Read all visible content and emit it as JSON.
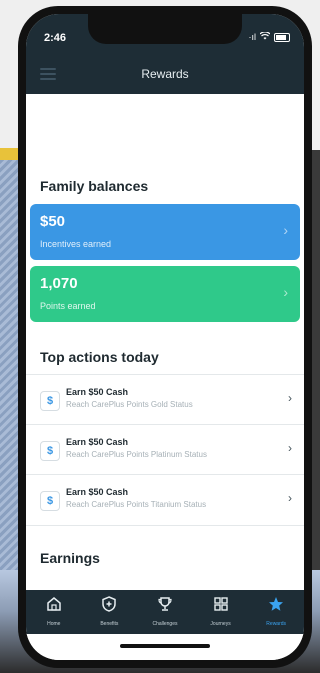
{
  "status": {
    "time": "2:46",
    "signal": "·ıl"
  },
  "header": {
    "title": "Rewards"
  },
  "family_balances": {
    "title": "Family balances",
    "cards": [
      {
        "value": "$50",
        "label": "Incentives earned",
        "color": "#3a97e4"
      },
      {
        "value": "1,070",
        "label": "Points earned",
        "color": "#2fc98a"
      }
    ]
  },
  "top_actions": {
    "title": "Top actions today",
    "items": [
      {
        "icon": "$",
        "title": "Earn $50 Cash",
        "subtitle": "Reach CarePlus Points Gold Status"
      },
      {
        "icon": "$",
        "title": "Earn $50 Cash",
        "subtitle": "Reach CarePlus Points Platinum Status"
      },
      {
        "icon": "$",
        "title": "Earn $50 Cash",
        "subtitle": "Reach CarePlus Points Titanium Status"
      }
    ]
  },
  "earnings": {
    "title": "Earnings"
  },
  "tabs": [
    {
      "label": "Home",
      "icon": "home-icon"
    },
    {
      "label": "Benefits",
      "icon": "shield-plus-icon"
    },
    {
      "label": "Challenges",
      "icon": "trophy-icon"
    },
    {
      "label": "Journeys",
      "icon": "grid-icon"
    },
    {
      "label": "Rewards",
      "icon": "star-icon",
      "active": true
    }
  ],
  "colors": {
    "nav": "#1e2d36",
    "accent": "#3aa3f0",
    "blue_card": "#3a97e4",
    "green_card": "#2fc98a"
  }
}
